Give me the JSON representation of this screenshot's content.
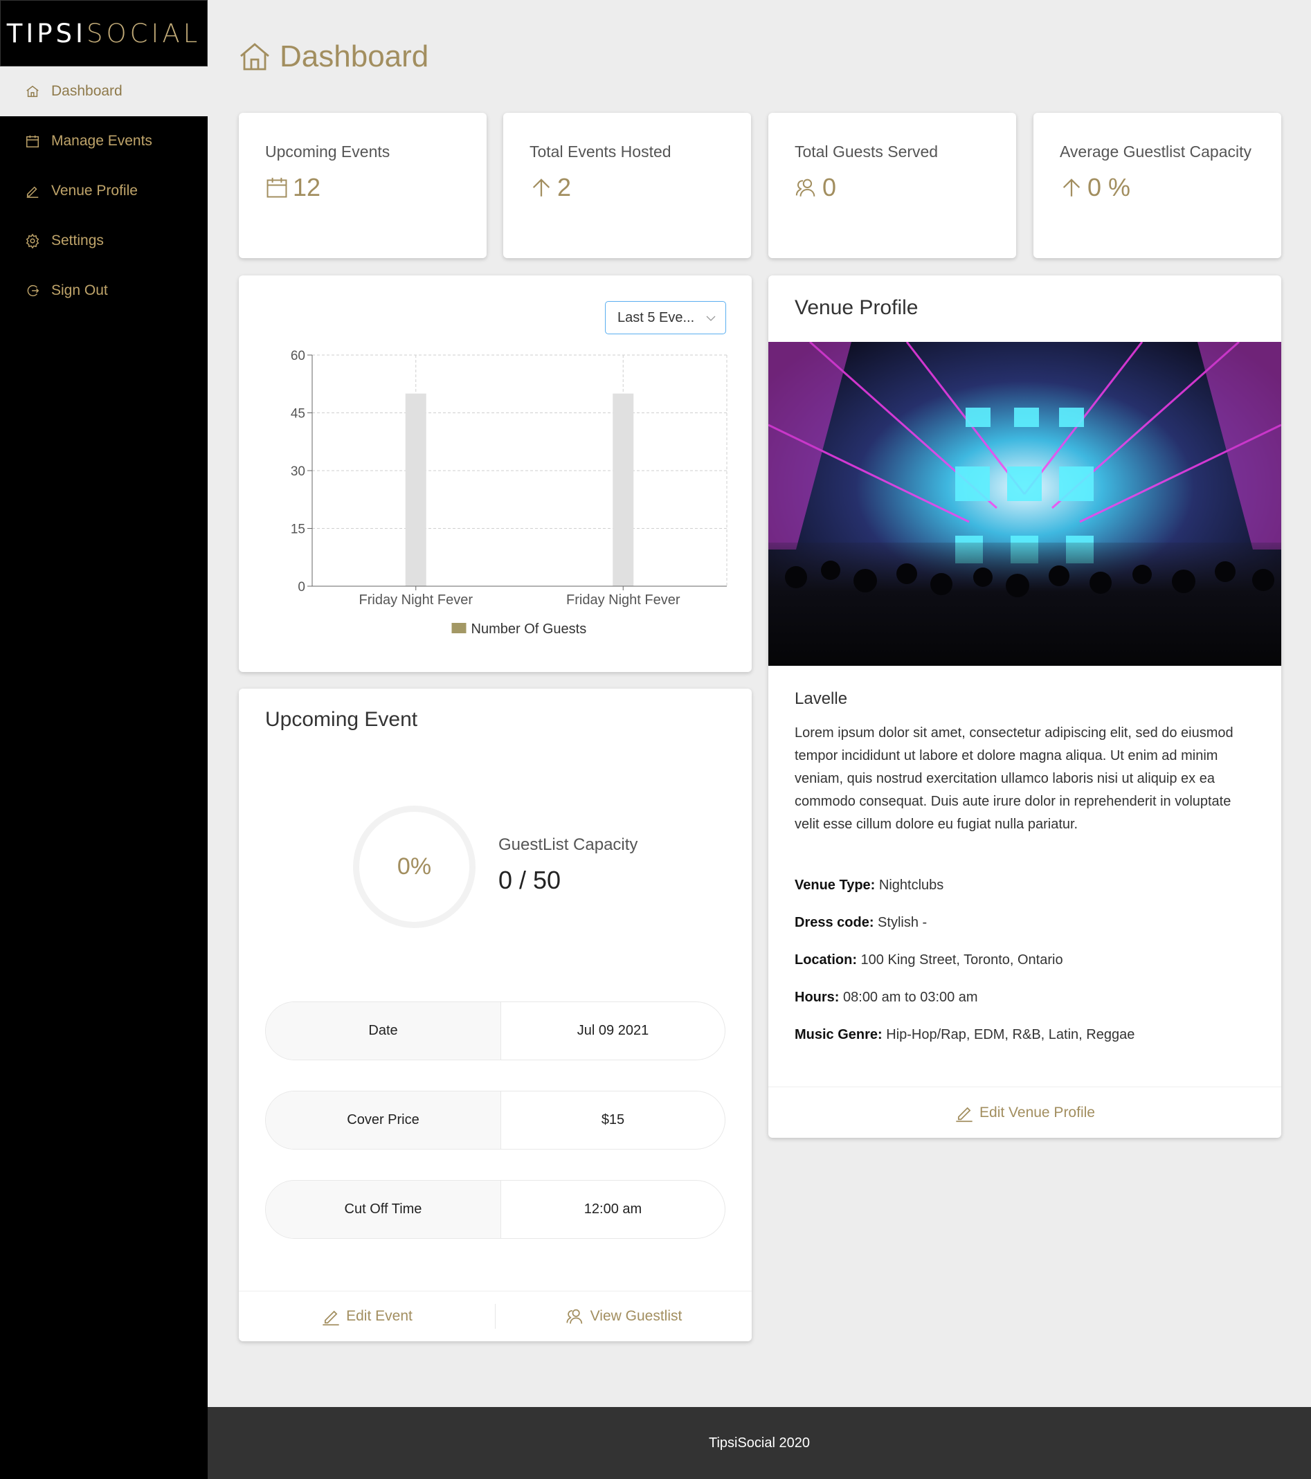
{
  "brand": {
    "part1": "TIPSI",
    "part2": "SOCIAL"
  },
  "colors": {
    "accent": "#a28e5f",
    "sidebar": "#000000",
    "background": "#ededed",
    "bar": "#e0e0e0",
    "legend": "#a39865"
  },
  "sidebar": {
    "items": [
      {
        "label": "Dashboard",
        "icon": "home-icon",
        "active": true
      },
      {
        "label": "Manage Events",
        "icon": "calendar-icon"
      },
      {
        "label": "Venue Profile",
        "icon": "pencil-icon"
      },
      {
        "label": "Settings",
        "icon": "gear-icon"
      },
      {
        "label": "Sign Out",
        "icon": "signout-icon"
      }
    ]
  },
  "header": {
    "title": "Dashboard"
  },
  "stats": [
    {
      "label": "Upcoming Events",
      "value": "12",
      "icon": "calendar-icon"
    },
    {
      "label": "Total Events Hosted",
      "value": "2",
      "icon": "arrow-up-icon"
    },
    {
      "label": "Total Guests Served",
      "value": "0",
      "icon": "users-icon"
    },
    {
      "label": "Average Guestlist Capacity",
      "value": "0 %",
      "icon": "arrow-up-icon"
    }
  ],
  "chart_card": {
    "dropdown": "Last 5 Eve..."
  },
  "chart_data": {
    "type": "bar",
    "categories": [
      "Friday Night Fever",
      "Friday Night Fever"
    ],
    "series": [
      {
        "name": "Number Of Guests",
        "values": [
          50,
          50
        ]
      }
    ],
    "yticks": [
      "0",
      "15",
      "30",
      "45",
      "60"
    ],
    "ylim": [
      0,
      60
    ],
    "xlabel": "",
    "ylabel": "",
    "grid": true,
    "legend": "bottom"
  },
  "upcoming_event": {
    "title": "Upcoming Event",
    "percent_label": "0%",
    "percent": 0,
    "capacity_label": "GuestList Capacity",
    "capacity_value": "0 / 50",
    "rows": [
      {
        "key": "Date",
        "value": "Jul 09 2021"
      },
      {
        "key": "Cover Price",
        "value": "$15"
      },
      {
        "key": "Cut Off Time",
        "value": "12:00 am"
      }
    ],
    "edit_label": "Edit Event",
    "guestlist_label": "View Guestlist"
  },
  "venue": {
    "title": "Venue Profile",
    "name": "Lavelle",
    "description": "Lorem ipsum dolor sit amet, consectetur adipiscing elit, sed do eiusmod tempor incididunt ut labore et dolore magna aliqua. Ut enim ad minim veniam, quis nostrud exercitation ullamco laboris nisi ut aliquip ex ea commodo consequat. Duis aute irure dolor in reprehenderit in voluptate velit esse cillum dolore eu fugiat nulla pariatur.",
    "fields": [
      {
        "key": "Venue Type:",
        "value": " Nightclubs"
      },
      {
        "key": "Dress code:",
        "value": " Stylish -"
      },
      {
        "key": "Location:",
        "value": " 100 King Street, Toronto, Ontario"
      },
      {
        "key": "Hours:",
        "value": " 08:00 am to 03:00 am"
      },
      {
        "key": "Music Genre:",
        "value": " Hip-Hop/Rap, EDM, R&B, Latin, Reggae"
      }
    ],
    "edit_label": "Edit Venue Profile"
  },
  "footer": {
    "text": "TipsiSocial 2020"
  }
}
